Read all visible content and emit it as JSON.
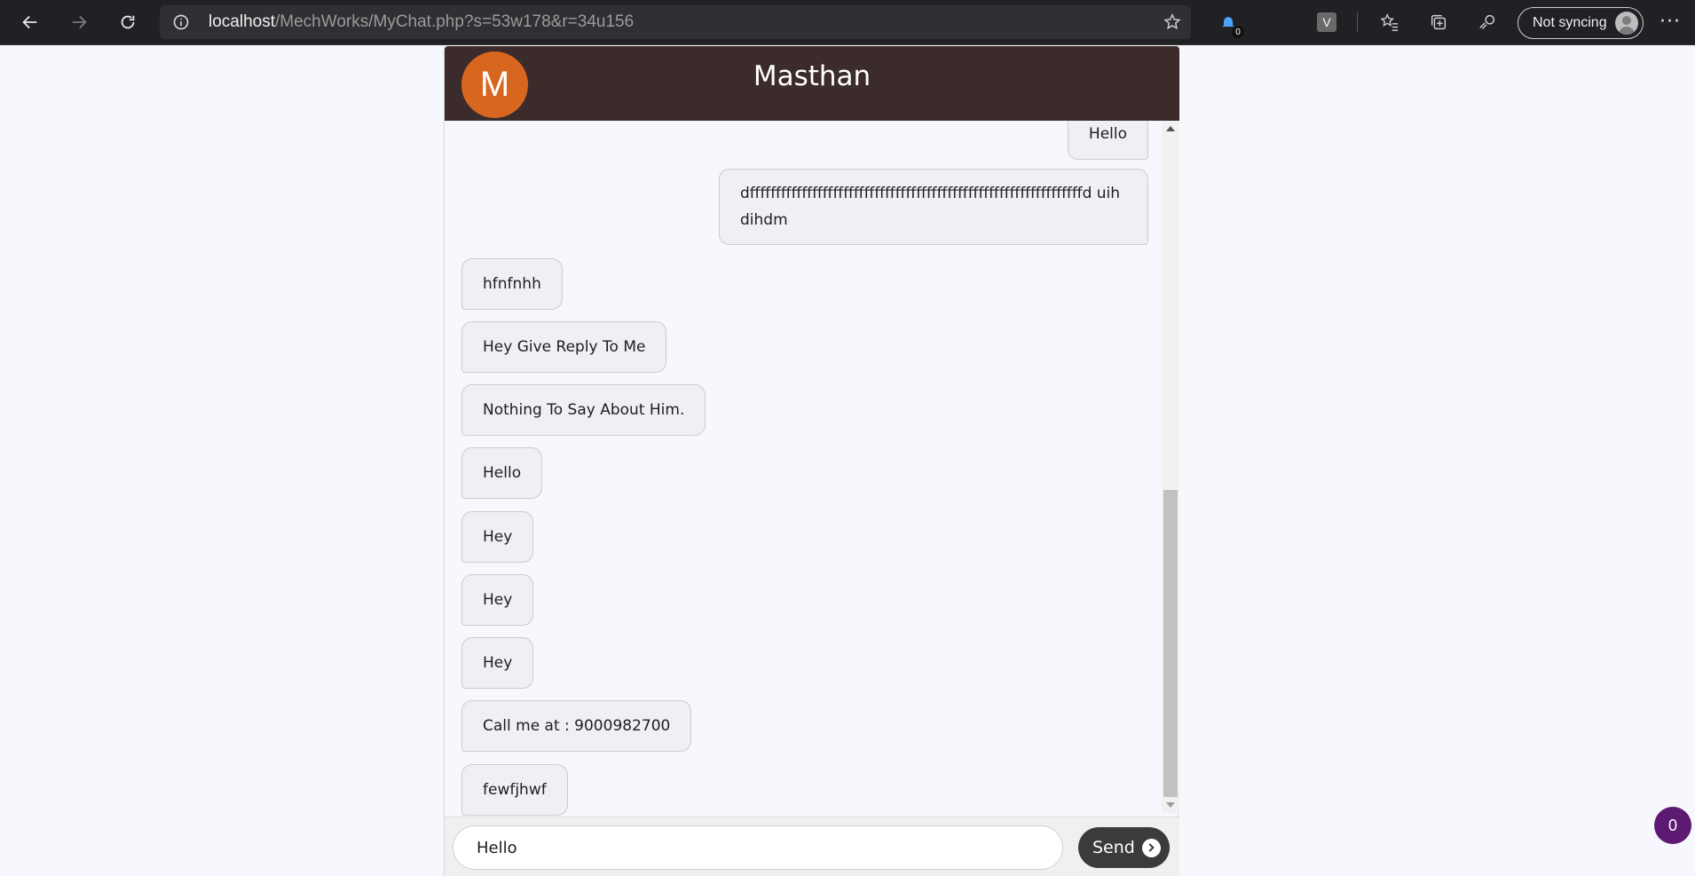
{
  "browser": {
    "url_host": "localhost",
    "url_path": "/MechWorks/MyChat.php?s=53w178&r=34u156",
    "extension_badge": "0",
    "extension_v_label": "V",
    "sync_label": "Not syncing",
    "more_label": "···"
  },
  "chat": {
    "avatar_letter": "M",
    "title": "Masthan",
    "messages": [
      {
        "side": "sent",
        "text": "Hello"
      },
      {
        "side": "sent",
        "text": "dffffffffffffffffffffffffffffffffffffffffffffffffffffffffffffffffd uihdihdm"
      },
      {
        "side": "received",
        "text": "hfnfnhh"
      },
      {
        "side": "received",
        "text": "Hey Give Reply To Me"
      },
      {
        "side": "received",
        "text": "Nothing To Say About Him."
      },
      {
        "side": "received",
        "text": "Hello"
      },
      {
        "side": "received",
        "text": "Hey"
      },
      {
        "side": "received",
        "text": "Hey"
      },
      {
        "side": "received",
        "text": "Hey"
      },
      {
        "side": "received",
        "text": "Call me at : 9000982700"
      },
      {
        "side": "received",
        "text": "fewfjhwf"
      }
    ],
    "input_value": "Hello",
    "send_label": "Send"
  },
  "notification_count": "0",
  "colors": {
    "header_bg": "#3b2b2a",
    "avatar_bg": "#d8661f",
    "send_bg": "#3b3b3b",
    "notification_bg": "#5d1a73"
  }
}
